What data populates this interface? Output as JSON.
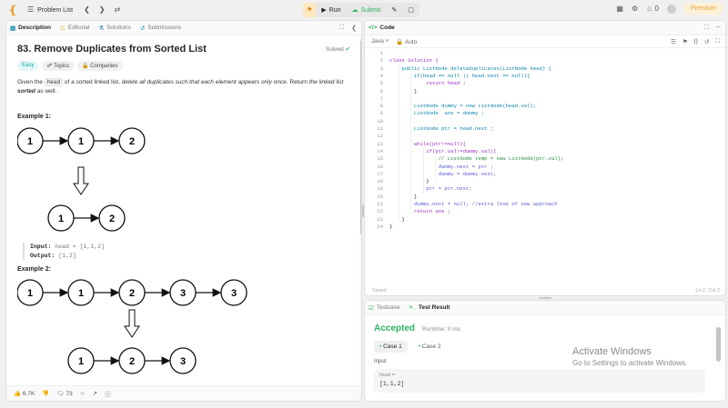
{
  "topbar": {
    "problem_list_label": "Problem List",
    "run_label": "Run",
    "submit_label": "Submit",
    "streak_count": "0",
    "premium_label": "Premium"
  },
  "left_tabs": [
    {
      "label": "Description",
      "icon": "description-icon"
    },
    {
      "label": "Editorial",
      "icon": "editorial-icon"
    },
    {
      "label": "Solutions",
      "icon": "flask-icon"
    },
    {
      "label": "Submissions",
      "icon": "history-icon"
    }
  ],
  "problem": {
    "title": "83. Remove Duplicates from Sorted List",
    "status": "Solved",
    "difficulty": "Easy",
    "topics_label": "Topics",
    "companies_label": "Companies",
    "desc_p1": "Given the",
    "desc_code": "head",
    "desc_p2": "of a sorted linked list,",
    "desc_p2_em": "delete all duplicates such that each element appears only once",
    "desc_p3": ". Return",
    "desc_p3_em": "the linked list",
    "desc_p4_strong": "sorted",
    "desc_p5": "as well."
  },
  "examples": [
    {
      "title": "Example 1:",
      "input_label": "Input:",
      "input_value": "head = [1,1,2]",
      "output_label": "Output:",
      "output_value": "[1,2]",
      "before_nodes": [
        "1",
        "1",
        "2"
      ],
      "after_nodes": [
        "1",
        "2"
      ]
    },
    {
      "title": "Example 2:",
      "before_nodes": [
        "1",
        "1",
        "2",
        "3",
        "3"
      ],
      "after_nodes": [
        "1",
        "2",
        "3"
      ]
    }
  ],
  "footer": {
    "likes": "6.7K",
    "comments": "73"
  },
  "code_panel": {
    "tab_label": "Code",
    "language": "Java",
    "mode": "Auto",
    "status_left": "Saved",
    "status_right": "Ln 2, Col 2",
    "lines": [
      "",
      "class Solution {",
      "    public ListNode deleteDuplicates(ListNode head) {",
      "        if(head == null || head.next == null){",
      "            return head ;",
      "        }",
      "",
      "        ListNode dummy = new ListNode(head.val);",
      "        ListNode  ans = dummy ;",
      "",
      "        ListNode ptr = head.next ;",
      "",
      "        while(ptr!=null){",
      "            if(ptr.val!=dummy.val){",
      "                // ListNode temp = new ListNode(ptr.val);",
      "                dummy.next = ptr ;",
      "                dummy = dummy.next;",
      "            }",
      "            ptr = ptr.next;",
      "        }",
      "        dummy.next = null; //extra line of new approach",
      "        return ans ;",
      "    }",
      "}"
    ]
  },
  "result_panel": {
    "testcase_tab": "Testcase",
    "result_tab": "Test Result",
    "verdict": "Accepted",
    "runtime": "Runtime: 0 ms",
    "case1": "Case 1",
    "case2": "Case 2",
    "input_label": "Input",
    "param_label": "head =",
    "param_value": "[1,1,2]"
  },
  "watermark": {
    "line1": "Activate Windows",
    "line2": "Go to Settings to activate Windows."
  },
  "colors": {
    "accepted": "#2db55d",
    "easy": "#00aaaa",
    "premium": "#e8a13a"
  }
}
